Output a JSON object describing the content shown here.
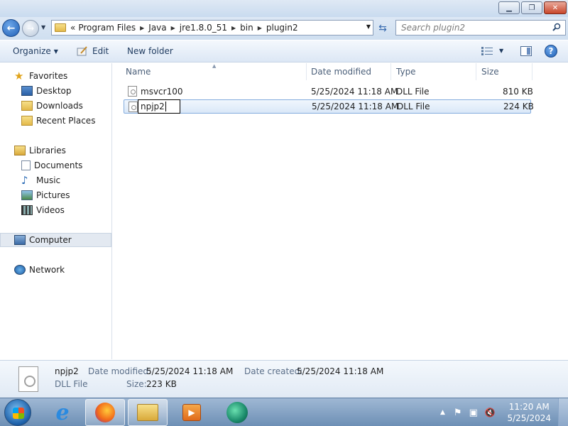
{
  "window": {
    "minimize": "▁",
    "maximize": "❐",
    "close": "✕"
  },
  "address": {
    "prefix": "«",
    "crumbs": [
      "Program Files",
      "Java",
      "jre1.8.0_51",
      "bin",
      "plugin2"
    ],
    "search_placeholder": "Search plugin2"
  },
  "toolbar": {
    "organize": "Organize",
    "edit": "Edit",
    "new_folder": "New folder"
  },
  "sidebar": {
    "favorites": "Favorites",
    "desktop": "Desktop",
    "downloads": "Downloads",
    "recent_places": "Recent Places",
    "libraries": "Libraries",
    "documents": "Documents",
    "music": "Music",
    "pictures": "Pictures",
    "videos": "Videos",
    "computer": "Computer",
    "network": "Network"
  },
  "columns": {
    "name": "Name",
    "date_modified": "Date modified",
    "type": "Type",
    "size": "Size"
  },
  "files": [
    {
      "name": "msvcr100",
      "date": "5/25/2024 11:18 AM",
      "type": "DLL File",
      "size": "810 KB"
    },
    {
      "name": "npjp2",
      "date": "5/25/2024 11:18 AM",
      "type": "DLL File",
      "size": "224 KB"
    }
  ],
  "rename_value": "npjp2",
  "details": {
    "name": "npjp2",
    "type": "DLL File",
    "date_modified_label": "Date modified:",
    "date_modified": "5/25/2024 11:18 AM",
    "date_created_label": "Date created:",
    "date_created": "5/25/2024 11:18 AM",
    "size_label": "Size:",
    "size": "223 KB"
  },
  "taskbar": {
    "time": "11:20 AM",
    "date": "5/25/2024"
  }
}
